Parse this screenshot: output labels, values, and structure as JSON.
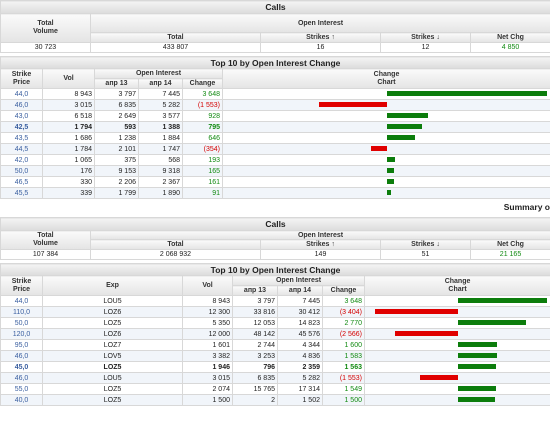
{
  "sec1": {
    "calls_title": "Calls",
    "h_total_volume": "Total\nVolume",
    "h_open_interest": "Open Interest",
    "h_total": "Total",
    "h_strikes_up": "Strikes ↑",
    "h_strikes_down": "Strikes ↓",
    "h_net_chg": "Net Chg",
    "total_volume": "30 723",
    "total": "433 807",
    "strikes_up": "16",
    "strikes_down": "12",
    "net_chg": "4 850",
    "top10_title": "Top 10 by Open Interest Change",
    "h_strike_price": "Strike\nPrice",
    "h_vol": "Vol",
    "h_apr13": "апр 13",
    "h_apr14": "апр 14",
    "h_change": "Change",
    "h_change_chart": "Change\nChart",
    "rows": [
      {
        "strike": "44,0",
        "vol": "8 943",
        "a13": "3 797",
        "a14": "7 445",
        "chg": "3 648",
        "v": 3648
      },
      {
        "strike": "46,0",
        "vol": "3 015",
        "a13": "6 835",
        "a14": "5 282",
        "chg": "(1 553)",
        "v": -1553
      },
      {
        "strike": "43,0",
        "vol": "6 518",
        "a13": "2 649",
        "a14": "3 577",
        "chg": "928",
        "v": 928
      },
      {
        "strike": "42,5",
        "vol": "1 794",
        "a13": "593",
        "a14": "1 388",
        "chg": "795",
        "v": 795,
        "bold": true
      },
      {
        "strike": "43,5",
        "vol": "1 686",
        "a13": "1 238",
        "a14": "1 884",
        "chg": "646",
        "v": 646
      },
      {
        "strike": "44,5",
        "vol": "1 784",
        "a13": "2 101",
        "a14": "1 747",
        "chg": "(354)",
        "v": -354
      },
      {
        "strike": "42,0",
        "vol": "1 065",
        "a13": "375",
        "a14": "568",
        "chg": "193",
        "v": 193
      },
      {
        "strike": "50,0",
        "vol": "176",
        "a13": "9 153",
        "a14": "9 318",
        "chg": "165",
        "v": 165
      },
      {
        "strike": "46,5",
        "vol": "330",
        "a13": "2 206",
        "a14": "2 367",
        "chg": "161",
        "v": 161
      },
      {
        "strike": "45,5",
        "vol": "339",
        "a13": "1 799",
        "a14": "1 890",
        "chg": "91",
        "v": 91
      }
    ]
  },
  "summary_label": "Summary o",
  "sec2": {
    "calls_title": "Calls",
    "h_total_volume": "Total\nVolume",
    "h_open_interest": "Open Interest",
    "h_total": "Total",
    "h_strikes_up": "Strikes ↑",
    "h_strikes_down": "Strikes ↓",
    "h_net_chg": "Net Chg",
    "total_volume": "107 384",
    "total": "2 068 932",
    "strikes_up": "149",
    "strikes_down": "51",
    "net_chg": "21 165",
    "top10_title": "Top 10 by Open Interest Change",
    "h_strike_price": "Strike\nPrice",
    "h_exp": "Exp",
    "h_vol": "Vol",
    "h_apr13": "апр 13",
    "h_apr14": "апр 14",
    "h_change": "Change",
    "h_change_chart": "Change\nChart",
    "rows": [
      {
        "strike": "44,0",
        "exp": "LOU5",
        "vol": "8 943",
        "a13": "3 797",
        "a14": "7 445",
        "chg": "3 648",
        "v": 3648
      },
      {
        "strike": "110,0",
        "exp": "LOZ6",
        "vol": "12 300",
        "a13": "33 816",
        "a14": "30 412",
        "chg": "(3 404)",
        "v": -3404
      },
      {
        "strike": "50,0",
        "exp": "LOZ5",
        "vol": "5 350",
        "a13": "12 053",
        "a14": "14 823",
        "chg": "2 770",
        "v": 2770
      },
      {
        "strike": "120,0",
        "exp": "LOZ6",
        "vol": "12 000",
        "a13": "48 142",
        "a14": "45 576",
        "chg": "(2 566)",
        "v": -2566
      },
      {
        "strike": "95,0",
        "exp": "LOZ7",
        "vol": "1 601",
        "a13": "2 744",
        "a14": "4 344",
        "chg": "1 600",
        "v": 1600
      },
      {
        "strike": "46,0",
        "exp": "LOV5",
        "vol": "3 382",
        "a13": "3 253",
        "a14": "4 836",
        "chg": "1 583",
        "v": 1583
      },
      {
        "strike": "45,0",
        "exp": "LOZ5",
        "vol": "1 946",
        "a13": "796",
        "a14": "2 359",
        "chg": "1 563",
        "v": 1563,
        "bold": true
      },
      {
        "strike": "46,0",
        "exp": "LOU5",
        "vol": "3 015",
        "a13": "6 835",
        "a14": "5 282",
        "chg": "(1 553)",
        "v": -1553
      },
      {
        "strike": "55,0",
        "exp": "LOZ5",
        "vol": "2 074",
        "a13": "15 765",
        "a14": "17 314",
        "chg": "1 549",
        "v": 1549
      },
      {
        "strike": "40,0",
        "exp": "LOZ5",
        "vol": "1 500",
        "a13": "2",
        "a14": "1 502",
        "chg": "1 500",
        "v": 1500
      }
    ]
  },
  "colors": {
    "positive": "#118a11",
    "negative": "#d40000",
    "bar_pos": "#0c7d0c",
    "bar_neg": "#e00000"
  }
}
